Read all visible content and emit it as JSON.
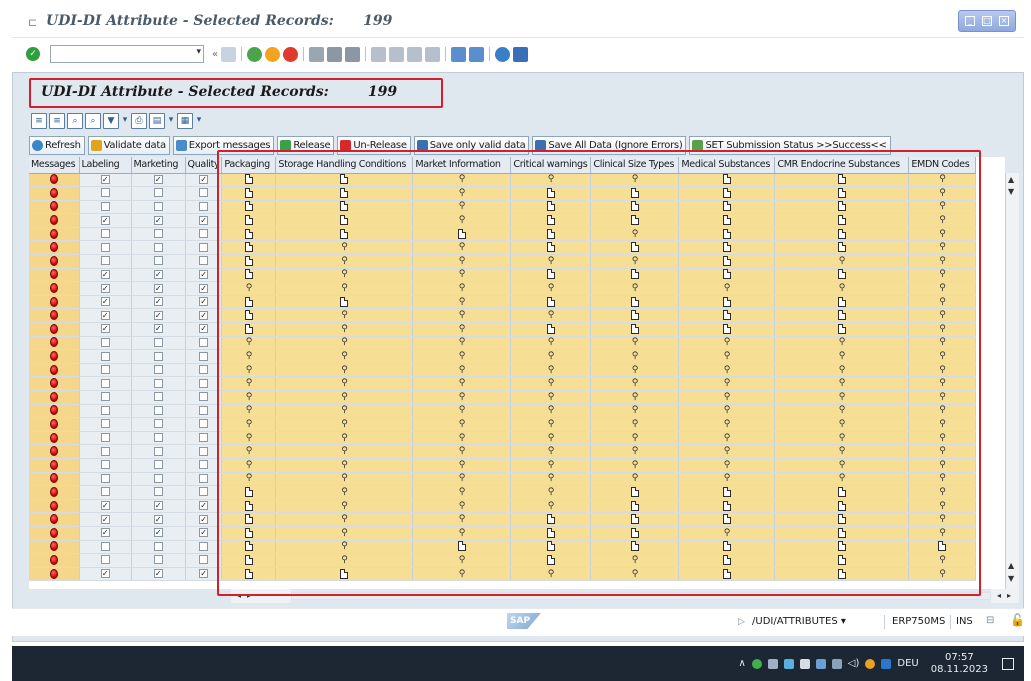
{
  "window": {
    "title_text": "UDI-DI Attribute - Selected Records:",
    "title_count": "199",
    "controls": [
      "minimize-icon",
      "maximize-icon",
      "close-icon"
    ]
  },
  "toolbar": {
    "command_field_value": "",
    "icons": [
      "enter-icon",
      "back-icon",
      "save-icon",
      "back-green-icon",
      "exit-icon",
      "cancel-icon",
      "print-icon",
      "find-icon",
      "find-next-icon",
      "first-page-icon",
      "prev-page-icon",
      "next-page-icon",
      "last-page-icon",
      "create-session-icon",
      "shortcut-icon",
      "help-icon",
      "customize-layout-icon"
    ]
  },
  "panel": {
    "title_text": "UDI-DI Attribute - Selected Records:",
    "title_count": "199"
  },
  "alv_toolbar_icons": [
    "sort-asc-icon",
    "sort-desc-icon",
    "find-icon",
    "find-next-icon",
    "filter-icon",
    "print-icon",
    "view-icon",
    "layout-icon"
  ],
  "app_buttons": [
    {
      "label": "Refresh",
      "icon": "refresh-icon",
      "color": "#3a86c8"
    },
    {
      "label": "Validate data",
      "icon": "validate-icon",
      "color": "#e0a31c"
    },
    {
      "label": "Export messages",
      "icon": "export-icon",
      "color": "#4a8cc9"
    },
    {
      "label": "Release",
      "icon": "green-flag-icon",
      "color": "#3aa04a"
    },
    {
      "label": "Un-Release",
      "icon": "red-flag-icon",
      "color": "#d42a2a"
    },
    {
      "label": "Save only valid data",
      "icon": "save-icon",
      "color": "#3a6fb0"
    },
    {
      "label": "Save All Data (Ignore Errors)",
      "icon": "save-icon",
      "color": "#3a6fb0"
    },
    {
      "label": "SET Submission Status >>Success<<",
      "icon": "checkmark-icon",
      "color": "#5aa04a"
    }
  ],
  "grid": {
    "columns": [
      "Messages",
      "Labeling",
      "Marketing",
      "Quality",
      "Packaging",
      "Storage Handling Conditions",
      "Market Information",
      "Critical warnings",
      "Clinical Size Types",
      "Medical Substances",
      "CMR Endocrine Substances",
      "EMDN Codes"
    ],
    "row_status": "error",
    "checked_rows": [
      0,
      3,
      7,
      8,
      9,
      10,
      11,
      24,
      25,
      26,
      29,
      30
    ],
    "rows_icons": [
      "DDLLLDDL",
      "DDLDDDDL",
      "DDLDDDDL",
      "DDLDDDDL",
      "DDDDLDDL",
      "DLLDDDDL",
      "DLLLLDLL",
      "DLLDDDDL",
      "LLLLLLLL",
      "DDLDDDDL",
      "DLLLDDDL",
      "DLLDDDDL",
      "LLLLLLLL",
      "LLLLLLLL",
      "LLLLLLLL",
      "LLLLLLLL",
      "LLLLLLLL",
      "LLLLLLLL",
      "LLLLLLLL",
      "LLLLLLLL",
      "LLLLLLLL",
      "LLLLLLLL",
      "LLLLLLLL",
      "DLLLDDDL",
      "DLLLDDDL",
      "DLLDDDDL",
      "DLLDDLDL",
      "DLDDDDDD",
      "DLLDLDDL",
      "DDLLLDDL"
    ]
  },
  "status": {
    "sap_logo": "SAP",
    "transaction": "/UDI/ATTRIBUTES",
    "system": "ERP750MS",
    "mode": "INS"
  },
  "taskbar": {
    "language": "DEU",
    "time": "07:57",
    "date": "08.11.2023"
  }
}
